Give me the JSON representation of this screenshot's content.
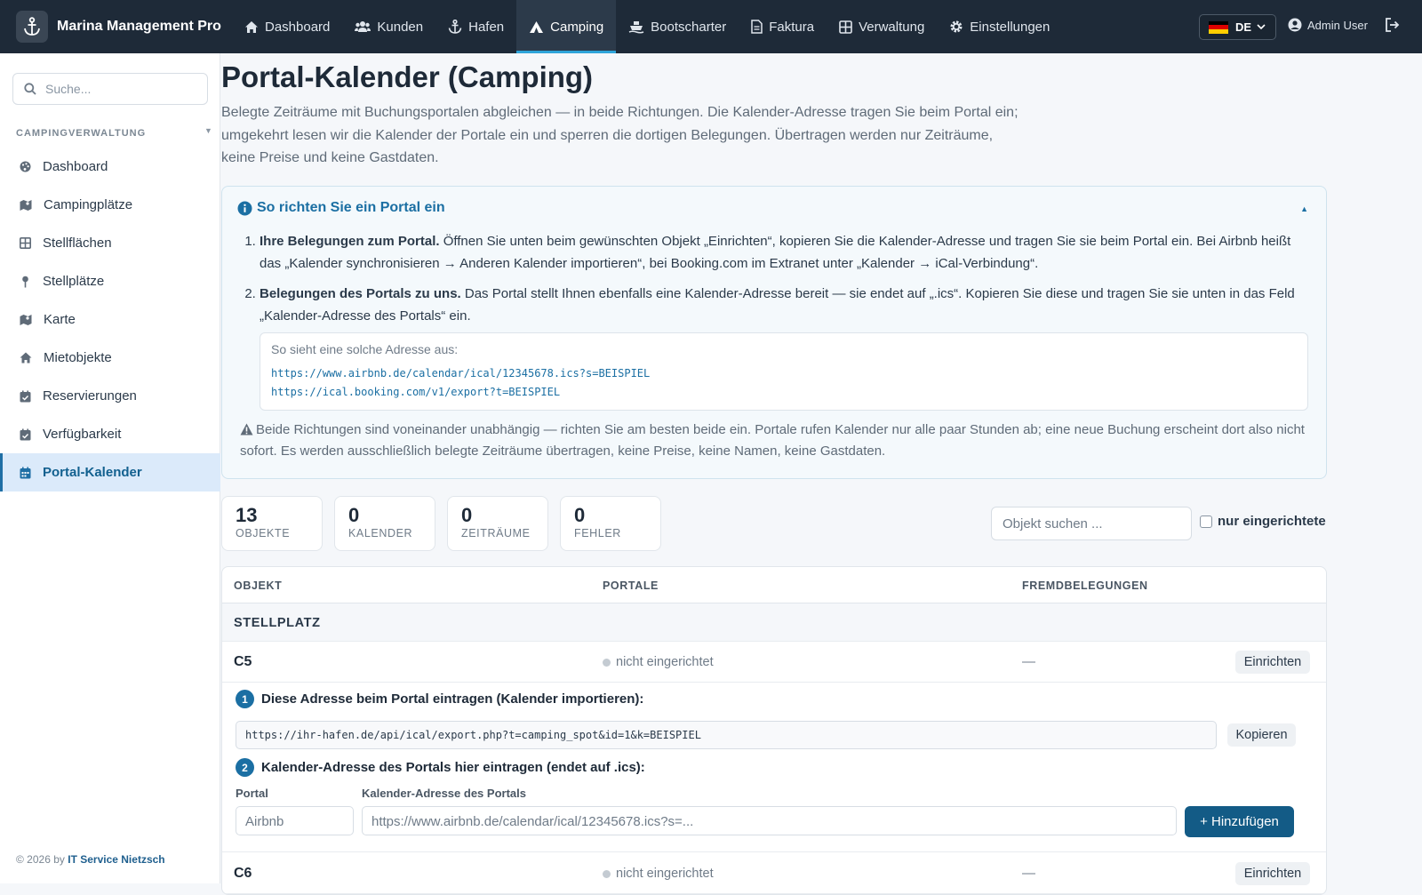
{
  "app": {
    "title": "Marina Management Pro"
  },
  "nav": [
    {
      "label": "Dashboard",
      "icon": "home-icon"
    },
    {
      "label": "Kunden",
      "icon": "users-icon"
    },
    {
      "label": "Hafen",
      "icon": "anchor-icon"
    },
    {
      "label": "Camping",
      "icon": "campground-icon",
      "active": true
    },
    {
      "label": "Bootscharter",
      "icon": "ship-icon"
    },
    {
      "label": "Faktura",
      "icon": "invoice-icon"
    },
    {
      "label": "Verwaltung",
      "icon": "grid-icon"
    },
    {
      "label": "Einstellungen",
      "icon": "gear-icon"
    }
  ],
  "lang": {
    "code": "DE"
  },
  "user": {
    "name": "Admin User"
  },
  "sidebar": {
    "search_placeholder": "Suche...",
    "section": "CAMPINGVERWALTUNG",
    "items": [
      {
        "label": "Dashboard",
        "icon": "palette-icon"
      },
      {
        "label": "Campingplätze",
        "icon": "map-icon"
      },
      {
        "label": "Stellflächen",
        "icon": "grid-icon"
      },
      {
        "label": "Stellplätze",
        "icon": "pin-icon"
      },
      {
        "label": "Karte",
        "icon": "map-icon"
      },
      {
        "label": "Mietobjekte",
        "icon": "home-icon"
      },
      {
        "label": "Reservierungen",
        "icon": "calendar-check-icon"
      },
      {
        "label": "Verfügbarkeit",
        "icon": "calendar-check-icon"
      },
      {
        "label": "Portal-Kalender",
        "icon": "calendar-icon",
        "active": true
      }
    ],
    "footer_prefix": "© 2026 by",
    "footer_link": "IT Service Nietzsch"
  },
  "page": {
    "title": "Portal-Kalender (Camping)",
    "description": "Belegte Zeiträume mit Buchungsportalen abgleichen — in beide Richtungen. Die Kalender-Adresse tragen Sie beim Portal ein; umgekehrt lesen wir die Kalender der Portale ein und sperren die dortigen Belegungen. Übertragen werden nur Zeiträume, keine Preise und keine Gastdaten."
  },
  "info": {
    "title": "So richten Sie ein Portal ein",
    "step1_bold": "Ihre Belegungen zum Portal.",
    "step1_text": " Öffnen Sie unten beim gewünschten Objekt „Einrichten“, kopieren Sie die Kalender-Adresse und tragen Sie sie beim Portal ein. Bei Airbnb heißt das „Kalender synchronisieren → Anderen Kalender importieren“, bei Booking.com im Extranet unter „Kalender → iCal-Verbindung“.",
    "step2_bold": "Belegungen des Portals zu uns.",
    "step2_text": " Das Portal stellt Ihnen ebenfalls eine Kalender-Adresse bereit — sie endet auf „.ics“. Kopieren Sie diese und tragen Sie sie unten in das Feld „Kalender-Adresse des Portals“ ein.",
    "example_label": "So sieht eine solche Adresse aus:",
    "example_url1": "https://www.airbnb.de/calendar/ical/12345678.ics?s=BEISPIEL",
    "example_url2": "https://ical.booking.com/v1/export?t=BEISPIEL",
    "note": "Beide Richtungen sind voneinander unabhängig — richten Sie am besten beide ein. Portale rufen Kalender nur alle paar Stunden ab; eine neue Buchung erscheint dort also nicht sofort. Es werden ausschließlich belegte Zeiträume übertragen, keine Preise, keine Namen, keine Gastdaten."
  },
  "stats": [
    {
      "value": "13",
      "label": "OBJEKTE"
    },
    {
      "value": "0",
      "label": "KALENDER"
    },
    {
      "value": "0",
      "label": "ZEITRÄUME"
    },
    {
      "value": "0",
      "label": "FEHLER"
    }
  ],
  "filter": {
    "search_placeholder": "Objekt suchen ...",
    "checkbox_label": "nur eingerichtete"
  },
  "table": {
    "headers": [
      "OBJEKT",
      "PORTALE",
      "FREMDBELEGUNGEN"
    ],
    "group": "STELLPLATZ",
    "rows": [
      {
        "name": "C5",
        "status": "nicht eingerichtet",
        "fremd": "—",
        "action": "Einrichten"
      },
      {
        "name": "C6",
        "status": "nicht eingerichtet",
        "fremd": "—",
        "action": "Einrichten"
      }
    ],
    "setup": {
      "step1": "Diese Adresse beim Portal eintragen (Kalender importieren):",
      "export_url": "https://ihr-hafen.de/api/ical/export.php?t=camping_spot&id=1&k=BEISPIEL",
      "copy": "Kopieren",
      "step2": "Kalender-Adresse des Portals hier eintragen (endet auf .ics):",
      "portal_label": "Portal",
      "portal_placeholder": "Airbnb",
      "url_label": "Kalender-Adresse des Portals",
      "url_placeholder": "https://www.airbnb.de/calendar/ical/12345678.ics?s=...",
      "add": "+ Hinzufügen"
    }
  }
}
